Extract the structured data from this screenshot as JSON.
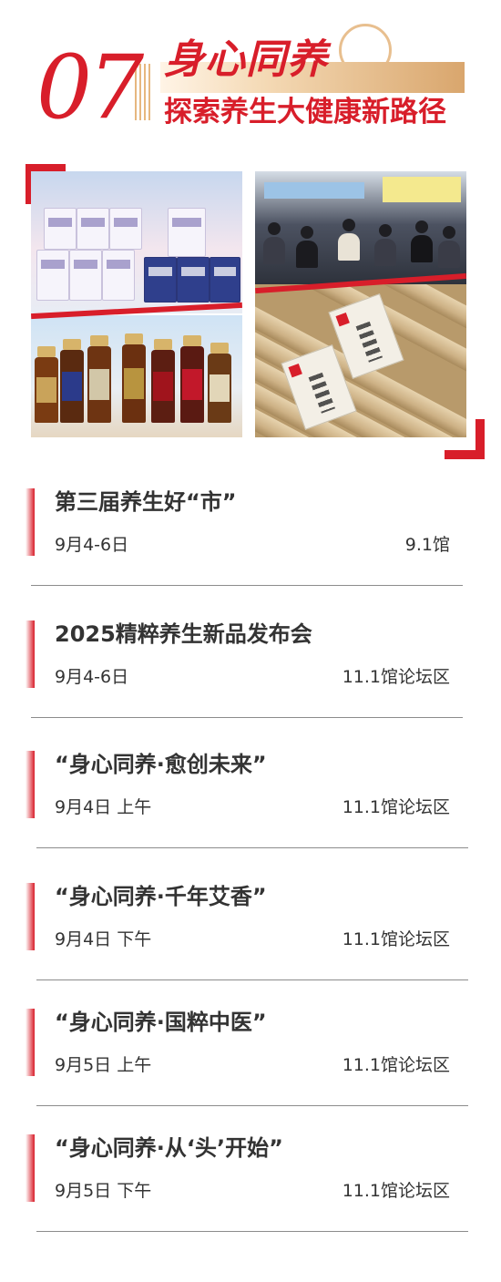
{
  "header": {
    "section_number": "07",
    "title": "身心同养",
    "subtitle": "探索养生大健康新路径"
  },
  "colors": {
    "accent": "#d81e2a",
    "gold": "#d9a66d",
    "text": "#333333",
    "divider": "#8c8c8c"
  },
  "photos": [
    {
      "subject": "health-supplement-boxes-photo"
    },
    {
      "subject": "audience-at-expo-photo"
    },
    {
      "subject": "oral-liquid-bottles-photo"
    },
    {
      "subject": "moxa-sticks-photo"
    }
  ],
  "events": [
    {
      "title": "第三届养生好“市”",
      "date": "9月4-6日",
      "venue": "9.1馆"
    },
    {
      "title": "2025精粹养生新品发布会",
      "date": "9月4-6日",
      "venue": "11.1馆论坛区"
    },
    {
      "title": "“身心同养·愈创未来”",
      "date": "9月4日 上午",
      "venue": "11.1馆论坛区"
    },
    {
      "title": "“身心同养·千年艾香”",
      "date": "9月4日 下午",
      "venue": "11.1馆论坛区"
    },
    {
      "title": "“身心同养·国粹中医”",
      "date": "9月5日 上午",
      "venue": "11.1馆论坛区"
    },
    {
      "title": "“身心同养·从‘头’开始”",
      "date": "9月5日 下午",
      "venue": "11.1馆论坛区"
    }
  ]
}
